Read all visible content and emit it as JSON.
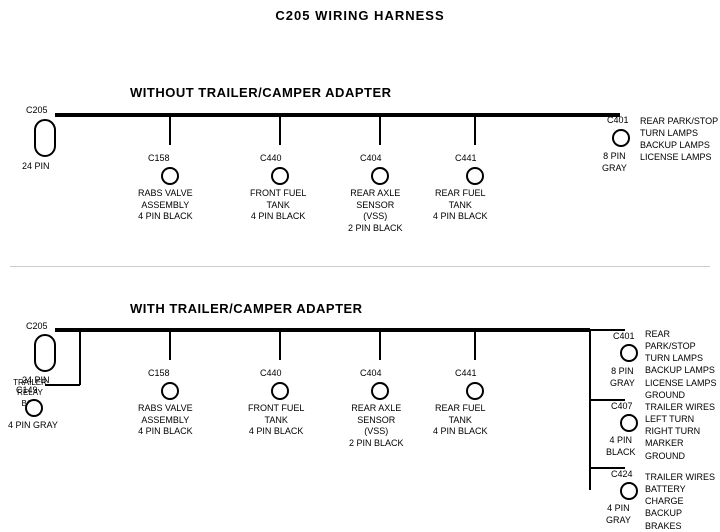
{
  "title": "C205 WIRING HARNESS",
  "section1": {
    "label": "WITHOUT  TRAILER/CAMPER ADAPTER",
    "left_connector": {
      "id": "C205",
      "pins": "24 PIN"
    },
    "right_connector": {
      "id": "C401",
      "pins": "8 PIN\nGRAY"
    },
    "right_labels": "REAR PARK/STOP\nTURN LAMPS\nBACKUP LAMPS\nLICENSE LAMPS",
    "connectors": [
      {
        "id": "C158",
        "label": "RABS VALVE\nASSEMBLY\n4 PIN BLACK"
      },
      {
        "id": "C440",
        "label": "FRONT FUEL\nTANK\n4 PIN BLACK"
      },
      {
        "id": "C404",
        "label": "REAR AXLE\nSENSOR\n(VSS)\n2 PIN BLACK"
      },
      {
        "id": "C441",
        "label": "REAR FUEL\nTANK\n4 PIN BLACK"
      }
    ]
  },
  "section2": {
    "label": "WITH  TRAILER/CAMPER ADAPTER",
    "left_connector": {
      "id": "C205",
      "pins": "24 PIN"
    },
    "right_connector": {
      "id": "C401",
      "pins": "8 PIN\nGRAY"
    },
    "right_labels_top": "REAR PARK/STOP\nTURN LAMPS\nBACKUP LAMPS\nLICENSE LAMPS\nGROUND",
    "extra_left": {
      "id": "TRAILER\nRELAY\nBOX"
    },
    "extra_left_conn": {
      "id": "C149",
      "pins": "4 PIN GRAY"
    },
    "connectors": [
      {
        "id": "C158",
        "label": "RABS VALVE\nASSEMBLY\n4 PIN BLACK"
      },
      {
        "id": "C440",
        "label": "FRONT FUEL\nTANK\n4 PIN BLACK"
      },
      {
        "id": "C404",
        "label": "REAR AXLE\nSENSOR\n(VSS)\n2 PIN BLACK"
      },
      {
        "id": "C441",
        "label": "REAR FUEL\nTANK\n4 PIN BLACK"
      }
    ],
    "right_connectors": [
      {
        "id": "C407",
        "pins": "4 PIN\nBLACK",
        "label": "TRAILER WIRES\nLEFT TURN\nRIGHT TURN\nMARKER\nGROUND"
      },
      {
        "id": "C424",
        "pins": "4 PIN\nGRAY",
        "label": "TRAILER WIRES\nBATTERY CHARGE\nBACKUP\nBRAKES"
      }
    ]
  }
}
